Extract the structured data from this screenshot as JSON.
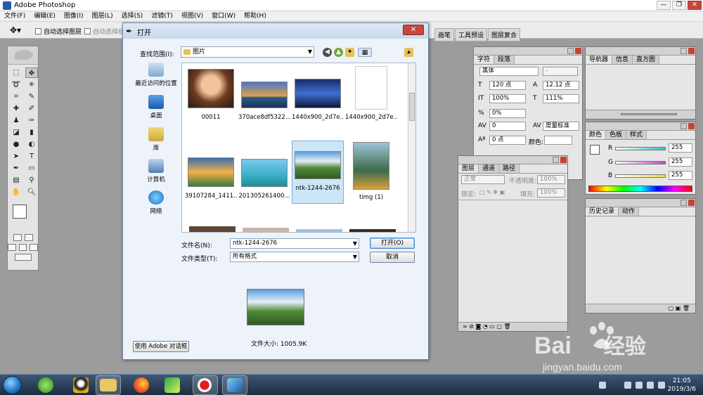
{
  "app": {
    "title": "Adobe Photoshop"
  },
  "menu": [
    "文件(F)",
    "编辑(E)",
    "图像(I)",
    "图层(L)",
    "选择(S)",
    "滤镜(T)",
    "视图(V)",
    "窗口(W)",
    "帮助(H)"
  ],
  "options": {
    "auto_select_layer": "自动选择图层",
    "auto_select_group": "自动选择组",
    "right_tabs": [
      "画笔",
      "工具预设",
      "图层复合"
    ]
  },
  "dialog": {
    "title": "打开",
    "look_in_label": "查找范围(I):",
    "look_in_value": "图片",
    "places": [
      "最近访问的位置",
      "桌面",
      "库",
      "计算机",
      "网络"
    ],
    "files": [
      {
        "name": "00011",
        "selected": false
      },
      {
        "name": "370ace8df5322...",
        "selected": false
      },
      {
        "name": "1440x900_2d7e...",
        "selected": false
      },
      {
        "name": "1440x900_2d7e...",
        "selected": false
      },
      {
        "name": "39107284_1411...",
        "selected": false
      },
      {
        "name": "201305261400...",
        "selected": false
      },
      {
        "name": "ntk-1244-2676",
        "selected": true
      },
      {
        "name": "timg (1)",
        "selected": false
      }
    ],
    "filename_label": "文件名(N):",
    "filename_value": "ntk-1244-2676",
    "filetype_label": "文件类型(T):",
    "filetype_value": "所有格式",
    "open_button": "打开(O)",
    "cancel_button": "取消",
    "use_adobe_button": "使用 Adobe 对话框",
    "file_size": "文件大小: 1005.9K"
  },
  "char_panel": {
    "tabs": [
      "字符",
      "段落"
    ],
    "font": "黑体",
    "style": "-",
    "size": "120 点",
    "leading": "12.12 点",
    "vscale": "100%",
    "hscale": "111%",
    "tracking_pct": "0%",
    "kerning": "0",
    "kerning_mode": "度量标准",
    "baseline": "0 点",
    "color_label": "颜色:"
  },
  "layers_panel": {
    "tabs": [
      "图层",
      "通道",
      "路径"
    ],
    "blend": "正常",
    "opacity_label": "不透明度:",
    "opacity": "100%",
    "lock_label": "锁定:",
    "fill_label": "填充:",
    "fill": "100%"
  },
  "navigator_panel": {
    "tabs": [
      "导航器",
      "信息",
      "直方图"
    ]
  },
  "color_panel": {
    "tabs": [
      "颜色",
      "色板",
      "样式"
    ],
    "channels": [
      {
        "label": "R",
        "value": "255",
        "color": "#2ec3c8"
      },
      {
        "label": "G",
        "value": "255",
        "color": "#d23fd1"
      },
      {
        "label": "B",
        "value": "255",
        "color": "#e8e342"
      }
    ]
  },
  "history_panel": {
    "tabs": [
      "历史记录",
      "动作"
    ]
  },
  "taskbar": {
    "time": "21:05",
    "date": "2019/3/6"
  },
  "watermark": {
    "brand": "Bai",
    "brand_cn": "经验",
    "url": "jingyan.baidu.com"
  }
}
